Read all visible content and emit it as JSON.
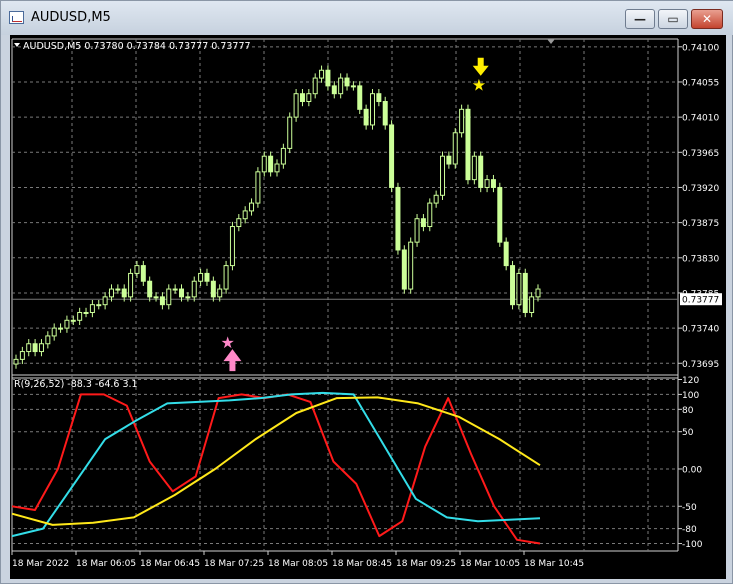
{
  "window": {
    "title": "AUDUSD,M5",
    "min_icon": "minimize-icon",
    "max_icon": "maximize-icon",
    "close_icon": "close-icon",
    "min_glyph": "—",
    "max_glyph": "▭",
    "close_glyph": "✕"
  },
  "colors": {
    "background": "#000000",
    "grid": "#7a7a7a",
    "candle": "#ccff99",
    "red_line": "#ff1a1a",
    "cyan_line": "#33dde8",
    "yellow_line": "#ffe81a",
    "sell_marker": "#ffee00",
    "buy_marker": "#ff88c8"
  },
  "chart_data": [
    {
      "type": "candlestick",
      "header": "AUDUSD,M5  0.73780 0.73784 0.73777 0.73777",
      "current_price_label": "0.73777",
      "y_ticks": [
        "0.74100",
        "0.74055",
        "0.74010",
        "0.73965",
        "0.73920",
        "0.73875",
        "0.73830",
        "0.73785",
        "0.73740",
        "0.73695"
      ],
      "ylim": [
        0.7368,
        0.7411
      ],
      "candles_close": [
        0.737,
        0.7371,
        0.7372,
        0.7371,
        0.7372,
        0.7373,
        0.7374,
        0.7374,
        0.7375,
        0.7375,
        0.7376,
        0.7376,
        0.7377,
        0.7377,
        0.7378,
        0.7379,
        0.7379,
        0.7378,
        0.7381,
        0.7382,
        0.738,
        0.7378,
        0.7378,
        0.7377,
        0.7379,
        0.7379,
        0.7378,
        0.7378,
        0.738,
        0.7381,
        0.738,
        0.7378,
        0.7379,
        0.7382,
        0.7387,
        0.7388,
        0.7389,
        0.739,
        0.7394,
        0.7396,
        0.7394,
        0.7395,
        0.7397,
        0.7401,
        0.7404,
        0.7403,
        0.7404,
        0.7406,
        0.7407,
        0.7405,
        0.7404,
        0.7406,
        0.7405,
        0.7405,
        0.7402,
        0.74,
        0.7404,
        0.7403,
        0.74,
        0.7392,
        0.7384,
        0.7379,
        0.7385,
        0.7388,
        0.7387,
        0.739,
        0.7391,
        0.7396,
        0.7395,
        0.7399,
        0.7402,
        0.7393,
        0.7396,
        0.7392,
        0.7393,
        0.7392,
        0.7385,
        0.7382,
        0.7377,
        0.7381,
        0.7376,
        0.7378,
        0.7379
      ],
      "markers": [
        {
          "type": "sell",
          "shape": "arrow-down",
          "candle_index": 73,
          "price": 0.7404
        },
        {
          "type": "buy",
          "shape": "arrow-up",
          "candle_index": 34,
          "price": 0.7374
        }
      ]
    },
    {
      "type": "line",
      "header": "R(9,26,52) -88.3 -64.6 3.1",
      "y_ticks": [
        "120",
        "100",
        "80",
        "50",
        "0.00",
        "-50",
        "-80",
        "-100"
      ],
      "ylim": [
        -110,
        122
      ],
      "x": [
        "18 Mar 2022",
        "18 Mar 06:05",
        "18 Mar 06:45",
        "18 Mar 07:25",
        "18 Mar 08:05",
        "18 Mar 08:45",
        "18 Mar 09:25",
        "18 Mar 10:05",
        "18 Mar 10:45"
      ],
      "series": [
        {
          "color": "red",
          "values": [
            -50,
            -55,
            0,
            100,
            100,
            85,
            10,
            -30,
            -10,
            95,
            100,
            95,
            100,
            90,
            10,
            -20,
            -90,
            -70,
            30,
            95,
            20,
            -50,
            -95,
            -100
          ]
        },
        {
          "color": "cyan",
          "values": [
            -90,
            -80,
            -20,
            40,
            65,
            88,
            90,
            92,
            95,
            100,
            102,
            100,
            30,
            -40,
            -65,
            -70,
            -68,
            -66
          ]
        },
        {
          "color": "yellow",
          "values": [
            -60,
            -75,
            -72,
            -65,
            -35,
            0,
            40,
            75,
            95,
            96,
            88,
            70,
            40,
            5
          ]
        }
      ]
    }
  ]
}
